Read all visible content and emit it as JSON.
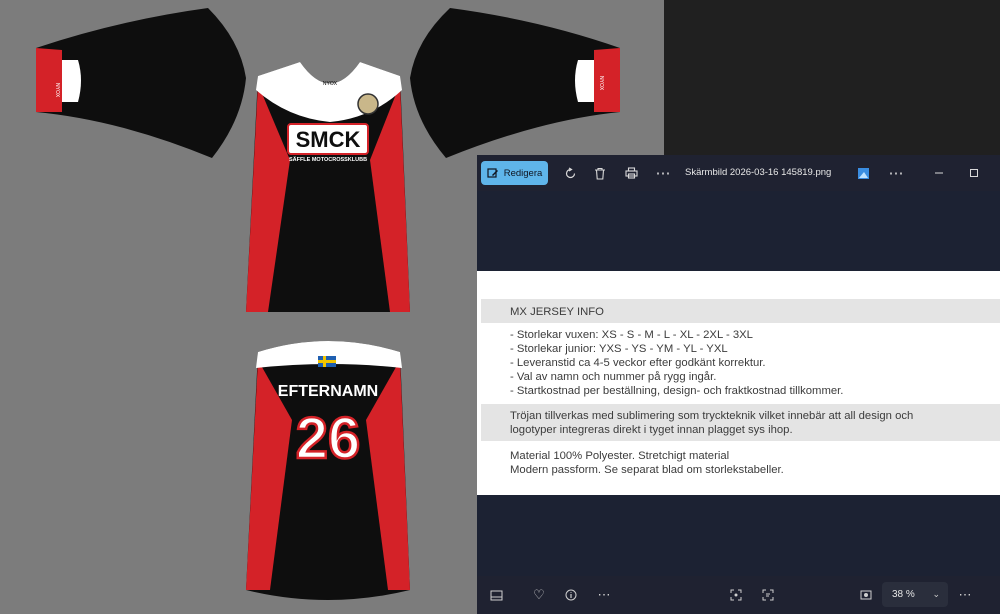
{
  "design": {
    "brand": "SMCK",
    "club_name": "SÄFFLE MOTOCROSSKLUBB",
    "rider_name": "EFTERNAMN",
    "rider_number": "26",
    "maker_mark": "NYOX",
    "colors": {
      "primary": "#0d0d0d",
      "accent": "#d42228",
      "panel": "#ffffff"
    }
  },
  "viewer": {
    "edit_label": "Redigera",
    "filename": "Skärmbild 2026-03-16 145819.png",
    "zoom": "38 %",
    "icons": {
      "rotate": "rotate-icon",
      "delete": "trash-icon",
      "print": "printer-icon",
      "more": "more-icon",
      "app": "photo-app-icon",
      "minimize": "minimize-icon",
      "maximize": "maximize-icon",
      "filmstrip": "filmstrip-icon",
      "favorite": "heart-icon",
      "info": "info-icon",
      "fit": "fit-icon",
      "ocr": "scan-text-icon",
      "zoom": "zoom-icon"
    }
  },
  "document": {
    "heading": "MX JERSEY INFO",
    "bullets": [
      "- Storlekar vuxen: XS - S - M - L - XL - 2XL - 3XL",
      "- Storlekar junior: YXS - YS - YM - YL - YXL",
      "- Leveranstid ca 4-5 veckor efter godkänt korrektur.",
      "- Val av namn och nummer på rygg ingår.",
      "- Startkostnad per beställning, design- och fraktkostnad tillkommer."
    ],
    "sublimation": [
      "Tröjan tillverkas med sublimering som tryckteknik vilket innebär att all design och",
      "logotyper integreras direkt i tyget innan plagget sys ihop."
    ],
    "material": [
      "Material 100% Polyester. Stretchigt material",
      "Modern passform. Se separat blad om storlekstabeller."
    ]
  }
}
